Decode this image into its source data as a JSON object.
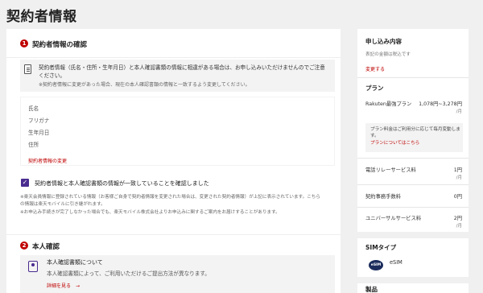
{
  "page": {
    "title": "契約者情報"
  },
  "section1": {
    "step": "1",
    "title": "契約者情報の確認",
    "notice": "契約者情報（氏名・住所・生年月日）と本人確認書類の情報に相違がある場合は、お申し込みいただけませんのでご注意ください。",
    "notice_sub": "※契約者情報に変更があった場合、現在の本人確認書類の情報と一致するよう変更してください。",
    "fields": [
      "氏名",
      "フリガナ",
      "生年月日",
      "住所"
    ],
    "change_link": "契約者情報の変更",
    "checkbox_label": "契約者情報と本人確認書類の情報が一致していることを確認しました",
    "notes": [
      "※楽天会員情報に登録されている情報（お客様ご自身で契約者情報を変更された場合は、変更された契約者情報）が上記に表示されています。こちら",
      "の情報は楽天モバイルに引き継がれます。",
      "※お申込み手続きが完了しなかった場合でも、楽天モバイル株式会社よりお申込みに関するご案内をお届けすることがあります。"
    ]
  },
  "section2": {
    "step": "2",
    "title": "本人確認",
    "card_title": "本人確認書類について",
    "card_sub": "本人確認書類によって、ご利用いただけるご提出方法が異なります。",
    "details_link": "詳細を見る　→"
  },
  "sidebar": {
    "title": "申し込み内容",
    "tax_note": "表記の金額は税込です",
    "change_link": "変更する",
    "plan_title": "プラン",
    "plan_name": "Rakuten最強プラン",
    "plan_price": "1,078円~3,278円",
    "plan_unit": "/月",
    "plan_note": "プラン料金はご利用分に応じて毎月変動します。",
    "plan_note_link": "プランについてはこちら",
    "rows": [
      {
        "label": "電話リレーサービス料",
        "value": "1円",
        "unit": "/月"
      },
      {
        "label": "契約事務手数料",
        "value": "0円",
        "unit": ""
      },
      {
        "label": "ユニバーサルサービス料",
        "value": "2円",
        "unit": "/月"
      }
    ],
    "sim_title": "SIMタイプ",
    "sim_badge": "eSIM",
    "sim_label": "eSIM",
    "product_title": "製品"
  }
}
